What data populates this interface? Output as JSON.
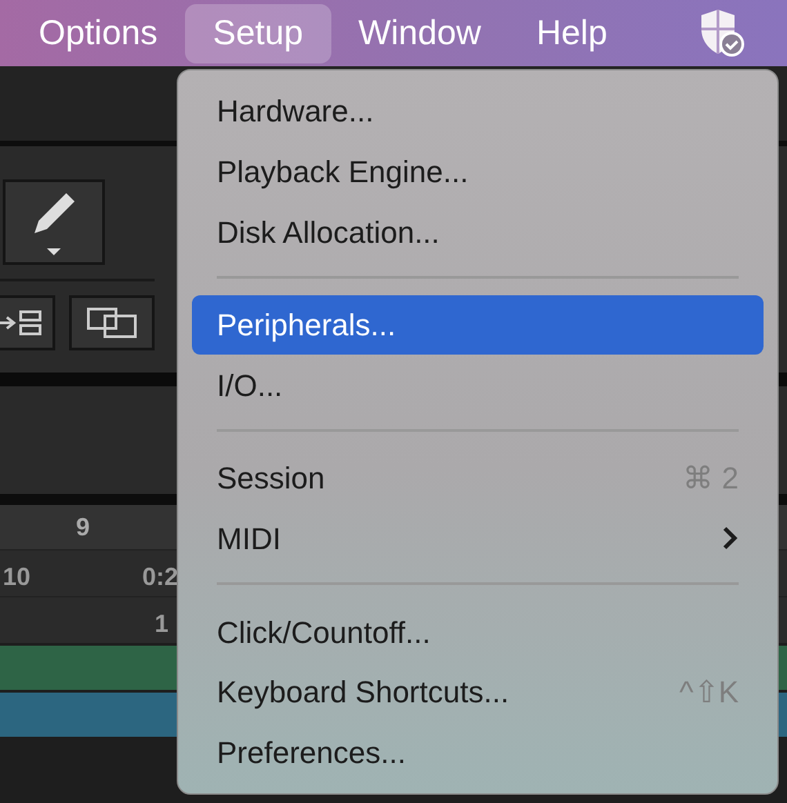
{
  "menu_bar": [
    {
      "label": "Options",
      "selected": false
    },
    {
      "label": "Setup",
      "selected": true
    },
    {
      "label": "Window",
      "selected": false
    },
    {
      "label": "Help",
      "selected": false
    }
  ],
  "setup_menu": [
    {
      "kind": "item",
      "label": "Hardware...",
      "selected": false
    },
    {
      "kind": "item",
      "label": "Playback Engine...",
      "selected": false
    },
    {
      "kind": "item",
      "label": "Disk Allocation...",
      "selected": false
    },
    {
      "kind": "separator"
    },
    {
      "kind": "item",
      "label": "Peripherals...",
      "selected": true
    },
    {
      "kind": "item",
      "label": "I/O...",
      "selected": false
    },
    {
      "kind": "separator"
    },
    {
      "kind": "item",
      "label": "Session",
      "selected": false,
      "shortcut": "⌘ 2"
    },
    {
      "kind": "submenu",
      "label": "MIDI",
      "selected": false
    },
    {
      "kind": "separator"
    },
    {
      "kind": "item",
      "label": "Click/Countoff...",
      "selected": false
    },
    {
      "kind": "item",
      "label": "Keyboard Shortcuts...",
      "selected": false,
      "shortcut": "^⇧K"
    },
    {
      "kind": "item",
      "label": "Preferences...",
      "selected": false
    }
  ],
  "timeline": {
    "bar_label": "9",
    "row_2": [
      "10",
      "0:2"
    ],
    "row_3": "1"
  }
}
